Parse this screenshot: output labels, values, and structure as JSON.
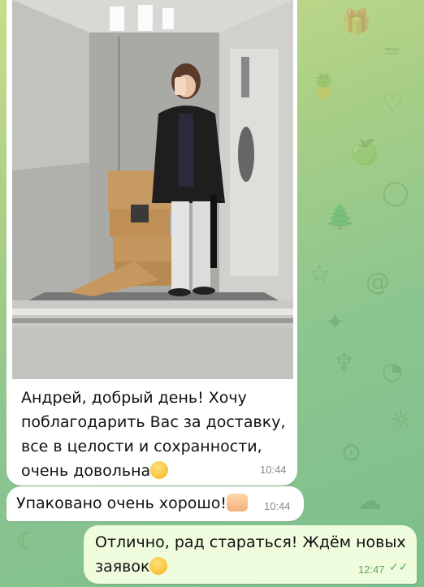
{
  "chat": {
    "messages": [
      {
        "direction": "incoming",
        "has_photo": true,
        "lines": [
          "Андрей, добрый день! Хочу",
          "поблагодарить Вас за доставку,",
          "все в целости и сохранности,",
          "очень довольна"
        ],
        "emoji": "smiling-face",
        "time": "10:44"
      },
      {
        "direction": "incoming",
        "text": "Упаковано очень хорошо!",
        "emoji": "thumbs-up",
        "time": "10:44"
      },
      {
        "direction": "outgoing",
        "lines": [
          "Отлично, рад стараться! Ждём новых",
          "заявок"
        ],
        "emoji": "relieved-face",
        "time": "12:47",
        "status": "read"
      }
    ]
  },
  "colors": {
    "incoming_bubble": "#ffffff",
    "outgoing_bubble": "#effdde",
    "read_check": "#4fae4e",
    "background_start": "#c9dc8a",
    "background_end": "#7cbf8c"
  }
}
